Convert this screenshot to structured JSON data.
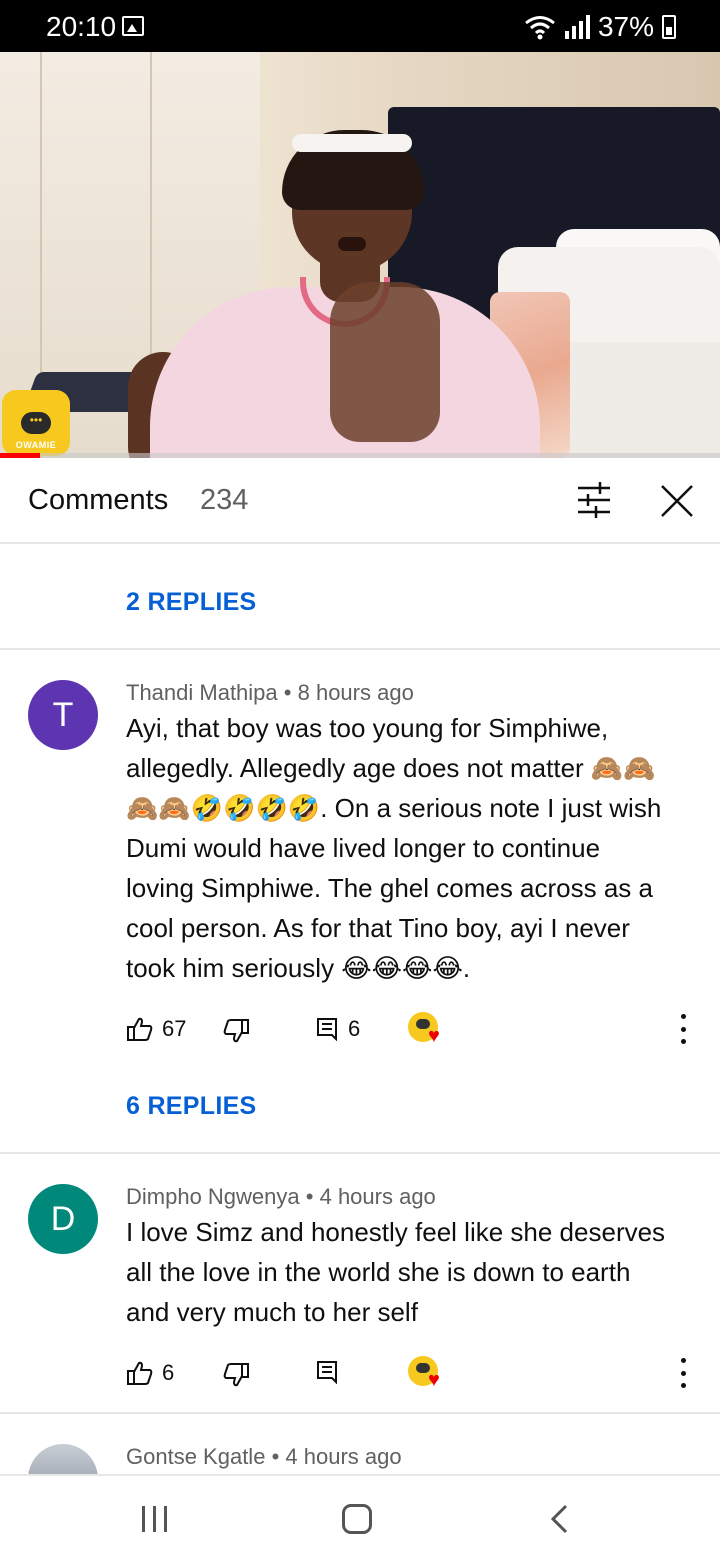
{
  "status_bar": {
    "time": "20:10",
    "battery": "37%",
    "icons": [
      "gallery-icon",
      "wifi-icon",
      "signal-icon",
      "battery-charging-icon"
    ]
  },
  "video": {
    "channel_logo_text": "OWAMIE",
    "progress": 0.056,
    "progress_color": "#ff0000"
  },
  "comments_panel": {
    "title": "Comments",
    "count": "234"
  },
  "items": [
    {
      "replies_label": "2 REPLIES"
    },
    {
      "author": "Thandi Mathipa",
      "time": "8 hours ago",
      "avatar_letter": "T",
      "avatar_color": "#5e35b1",
      "text_lines": [
        "Ayi, that boy was too young for Simphiwe,",
        "allegedly. Allegedly age does not matter 🙈🙈",
        "🙈🙈🤣🤣🤣🤣. On a serious note I just wish",
        "Dumi would have lived longer to continue",
        "loving Simphiwe. The ghel comes across as a",
        "cool person. As for that Tino boy, ayi I never",
        "took him seriously 😂😂😂😂."
      ],
      "likes": "67",
      "reply_count": "6",
      "replies_label": "6 REPLIES"
    },
    {
      "author": "Dimpho Ngwenya",
      "time": "4 hours ago",
      "avatar_letter": "D",
      "avatar_color": "#00897b",
      "text_lines": [
        "I love Simz and honestly feel like she deserves",
        "all the love in the world she is down to earth",
        "and very much to her self"
      ],
      "likes": "6",
      "reply_count": ""
    },
    {
      "author": "Gontse Kgatle",
      "time": "4 hours ago"
    }
  ],
  "nav_bar": {
    "icons": [
      "recents-icon",
      "home-icon",
      "back-icon"
    ]
  }
}
